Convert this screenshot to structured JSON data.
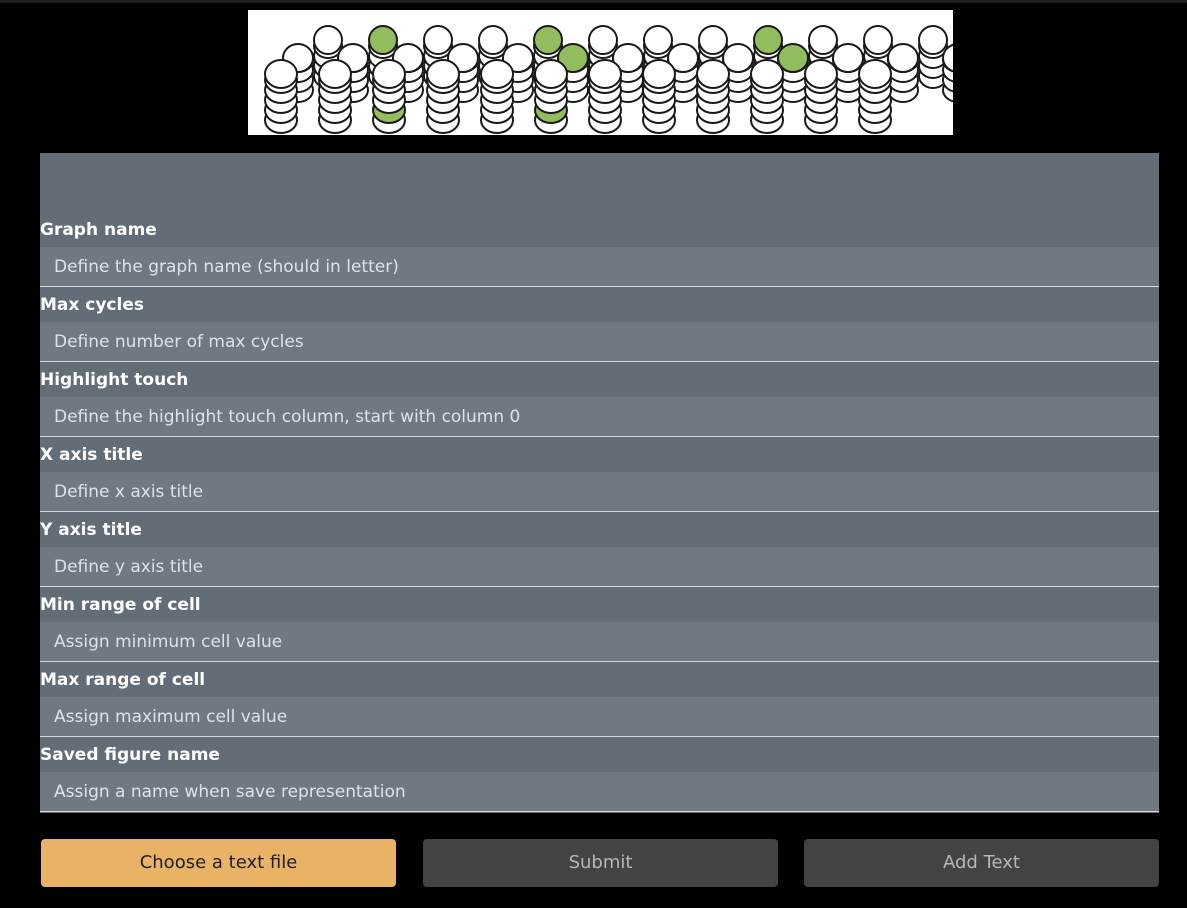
{
  "form": {
    "fields": [
      {
        "label": "Graph name",
        "placeholder": "Define the graph name (should in letter)"
      },
      {
        "label": "Max cycles",
        "placeholder": "Define number of max cycles"
      },
      {
        "label": "Highlight touch",
        "placeholder": "Define the highlight touch column, start with column 0"
      },
      {
        "label": "X axis title",
        "placeholder": "Define x axis title"
      },
      {
        "label": "Y axis title",
        "placeholder": "Define y axis title"
      },
      {
        "label": "Min range of cell",
        "placeholder": "Assign minimum cell value"
      },
      {
        "label": "Max range of cell",
        "placeholder": "Assign maximum cell value"
      },
      {
        "label": "Saved figure name",
        "placeholder": "Assign a name when save representation"
      }
    ]
  },
  "buttons": {
    "choose_label": "Choose a text file",
    "submit_label": "Submit",
    "add_text_label": "Add Text"
  },
  "colors": {
    "accent": "#e9b367",
    "panel": "#626d77",
    "input": "#6e7982",
    "highlight_green": "#92bd5e"
  },
  "icons": {
    "banner": "cell-stack-illustration"
  }
}
